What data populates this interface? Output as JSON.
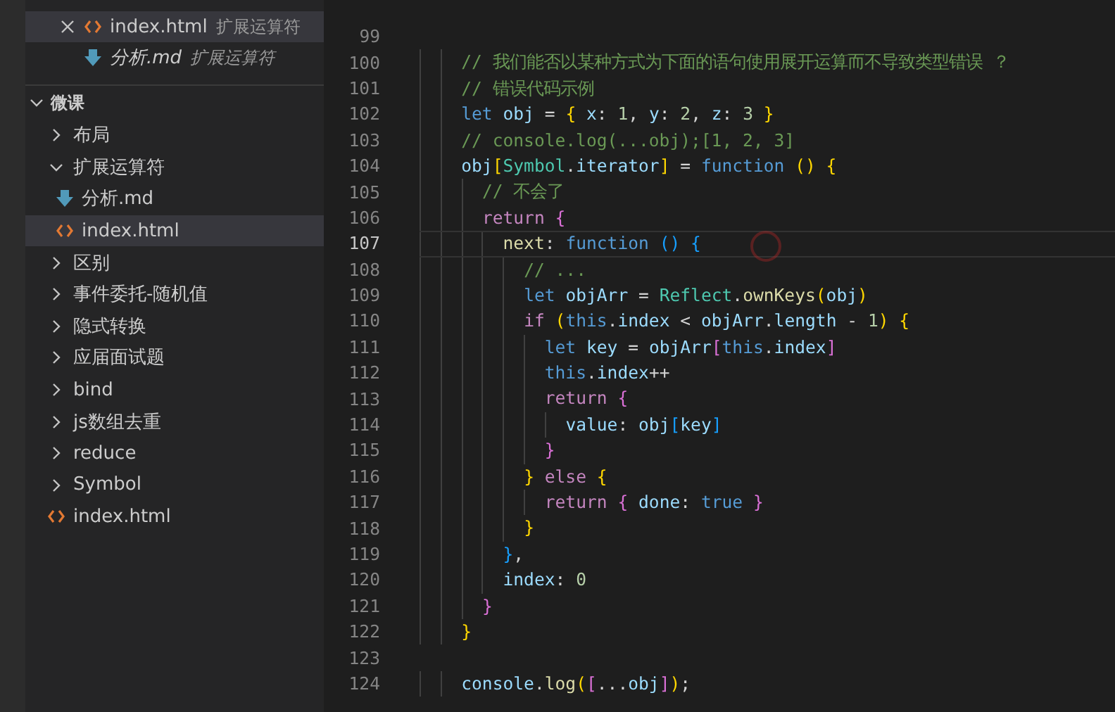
{
  "open_editors": [
    {
      "name": "index.html",
      "kind": "html",
      "description": "扩展运算符",
      "hovered": true,
      "preview": false
    },
    {
      "name": "分析.md",
      "kind": "md",
      "description": "扩展运算符",
      "hovered": false,
      "preview": true
    }
  ],
  "explorer": {
    "title": "微课",
    "expanded": true,
    "items": [
      {
        "name": "布局",
        "kind": "folder",
        "expanded": false,
        "selected": false
      },
      {
        "name": "扩展运算符",
        "kind": "folder",
        "expanded": true,
        "selected": false,
        "children": [
          {
            "name": "分析.md",
            "kind": "md",
            "selected": false
          },
          {
            "name": "index.html",
            "kind": "html",
            "selected": true
          }
        ]
      },
      {
        "name": "区别",
        "kind": "folder",
        "expanded": false,
        "selected": false
      },
      {
        "name": "事件委托-随机值",
        "kind": "folder",
        "expanded": false,
        "selected": false
      },
      {
        "name": "隐式转换",
        "kind": "folder",
        "expanded": false,
        "selected": false
      },
      {
        "name": "应届面试题",
        "kind": "folder",
        "expanded": false,
        "selected": false
      },
      {
        "name": "bind",
        "kind": "folder",
        "expanded": false,
        "selected": false
      },
      {
        "name": "js数组去重",
        "kind": "folder",
        "expanded": false,
        "selected": false
      },
      {
        "name": "reduce",
        "kind": "folder",
        "expanded": false,
        "selected": false
      },
      {
        "name": "Symbol",
        "kind": "folder",
        "expanded": false,
        "selected": false
      },
      {
        "name": "index.html",
        "kind": "html",
        "selected": false
      }
    ]
  },
  "editor": {
    "lines": [
      {
        "number": "99",
        "current": false
      },
      {
        "number": "100",
        "current": false,
        "tokens": [
          {
            "kind": "comment",
            "text": "    // 我们能否以某种方式为下面的语句使用展开运算而不导致类型错误 ？"
          }
        ]
      },
      {
        "number": "101",
        "current": false,
        "tokens": [
          {
            "kind": "comment",
            "text": "    // 错误代码示例"
          }
        ]
      },
      {
        "number": "102",
        "current": false,
        "tokens": [
          {
            "kind": "keyword",
            "text": "    let "
          },
          {
            "kind": "variable",
            "text": "obj"
          },
          {
            "kind": "plain",
            "text": " = "
          },
          {
            "kind": "brace1",
            "text": "{ "
          },
          {
            "kind": "variable",
            "text": "x"
          },
          {
            "kind": "plain",
            "text": ": "
          },
          {
            "kind": "number",
            "text": "1"
          },
          {
            "kind": "plain",
            "text": ", "
          },
          {
            "kind": "variable",
            "text": "y"
          },
          {
            "kind": "plain",
            "text": ": "
          },
          {
            "kind": "number",
            "text": "2"
          },
          {
            "kind": "plain",
            "text": ", "
          },
          {
            "kind": "variable",
            "text": "z"
          },
          {
            "kind": "plain",
            "text": ": "
          },
          {
            "kind": "number",
            "text": "3 "
          },
          {
            "kind": "brace1",
            "text": "}"
          }
        ]
      },
      {
        "number": "103",
        "current": false,
        "tokens": [
          {
            "kind": "comment",
            "text": "    // console.log(...obj);[1, 2, 3]"
          }
        ]
      },
      {
        "number": "104",
        "current": false,
        "tokens": [
          {
            "kind": "variable",
            "text": "    obj"
          },
          {
            "kind": "brace1",
            "text": "["
          },
          {
            "kind": "class",
            "text": "Symbol"
          },
          {
            "kind": "plain",
            "text": "."
          },
          {
            "kind": "variable",
            "text": "iterator"
          },
          {
            "kind": "brace1",
            "text": "]"
          },
          {
            "kind": "plain",
            "text": " = "
          },
          {
            "kind": "keyword",
            "text": "function "
          },
          {
            "kind": "brace1",
            "text": "() {"
          }
        ]
      },
      {
        "number": "105",
        "current": false,
        "tokens": [
          {
            "kind": "comment",
            "text": "      // 不会了"
          }
        ]
      },
      {
        "number": "106",
        "current": false,
        "tokens": [
          {
            "kind": "control",
            "text": "      return "
          },
          {
            "kind": "brace2",
            "text": "{"
          }
        ]
      },
      {
        "number": "107",
        "current": true,
        "tokens": [
          {
            "kind": "function",
            "text": "        next"
          },
          {
            "kind": "plain",
            "text": ": "
          },
          {
            "kind": "keyword",
            "text": "function "
          },
          {
            "kind": "brace3",
            "text": "() {"
          }
        ]
      },
      {
        "number": "108",
        "current": false,
        "tokens": [
          {
            "kind": "comment",
            "text": "          // ..."
          }
        ]
      },
      {
        "number": "109",
        "current": false,
        "tokens": [
          {
            "kind": "keyword",
            "text": "          let "
          },
          {
            "kind": "variable",
            "text": "objArr"
          },
          {
            "kind": "plain",
            "text": " = "
          },
          {
            "kind": "class",
            "text": "Reflect"
          },
          {
            "kind": "plain",
            "text": "."
          },
          {
            "kind": "function",
            "text": "ownKeys"
          },
          {
            "kind": "brace1",
            "text": "("
          },
          {
            "kind": "variable",
            "text": "obj"
          },
          {
            "kind": "brace1",
            "text": ")"
          }
        ]
      },
      {
        "number": "110",
        "current": false,
        "tokens": [
          {
            "kind": "control",
            "text": "          if "
          },
          {
            "kind": "brace1",
            "text": "("
          },
          {
            "kind": "keyword",
            "text": "this"
          },
          {
            "kind": "plain",
            "text": "."
          },
          {
            "kind": "variable",
            "text": "index"
          },
          {
            "kind": "plain",
            "text": " < "
          },
          {
            "kind": "variable",
            "text": "objArr"
          },
          {
            "kind": "plain",
            "text": "."
          },
          {
            "kind": "variable",
            "text": "length"
          },
          {
            "kind": "plain",
            "text": " - "
          },
          {
            "kind": "number",
            "text": "1"
          },
          {
            "kind": "brace1",
            "text": ") {"
          }
        ]
      },
      {
        "number": "111",
        "current": false,
        "tokens": [
          {
            "kind": "keyword",
            "text": "            let "
          },
          {
            "kind": "variable",
            "text": "key"
          },
          {
            "kind": "plain",
            "text": " = "
          },
          {
            "kind": "variable",
            "text": "objArr"
          },
          {
            "kind": "brace2",
            "text": "["
          },
          {
            "kind": "keyword",
            "text": "this"
          },
          {
            "kind": "plain",
            "text": "."
          },
          {
            "kind": "variable",
            "text": "index"
          },
          {
            "kind": "brace2",
            "text": "]"
          }
        ]
      },
      {
        "number": "112",
        "current": false,
        "tokens": [
          {
            "kind": "keyword",
            "text": "            this"
          },
          {
            "kind": "plain",
            "text": "."
          },
          {
            "kind": "variable",
            "text": "index"
          },
          {
            "kind": "plain",
            "text": "++"
          }
        ]
      },
      {
        "number": "113",
        "current": false,
        "tokens": [
          {
            "kind": "control",
            "text": "            return "
          },
          {
            "kind": "brace2",
            "text": "{"
          }
        ]
      },
      {
        "number": "114",
        "current": false,
        "tokens": [
          {
            "kind": "variable",
            "text": "              value"
          },
          {
            "kind": "plain",
            "text": ": "
          },
          {
            "kind": "variable",
            "text": "obj"
          },
          {
            "kind": "brace3",
            "text": "["
          },
          {
            "kind": "variable",
            "text": "key"
          },
          {
            "kind": "brace3",
            "text": "]"
          }
        ]
      },
      {
        "number": "115",
        "current": false,
        "tokens": [
          {
            "kind": "brace2",
            "text": "            }"
          }
        ]
      },
      {
        "number": "116",
        "current": false,
        "tokens": [
          {
            "kind": "brace1",
            "text": "          } "
          },
          {
            "kind": "control",
            "text": "else "
          },
          {
            "kind": "brace1",
            "text": "{"
          }
        ]
      },
      {
        "number": "117",
        "current": false,
        "tokens": [
          {
            "kind": "control",
            "text": "            return "
          },
          {
            "kind": "brace2",
            "text": "{ "
          },
          {
            "kind": "variable",
            "text": "done"
          },
          {
            "kind": "plain",
            "text": ": "
          },
          {
            "kind": "keyword",
            "text": "true "
          },
          {
            "kind": "brace2",
            "text": "}"
          }
        ]
      },
      {
        "number": "118",
        "current": false,
        "tokens": [
          {
            "kind": "brace1",
            "text": "          }"
          }
        ]
      },
      {
        "number": "119",
        "current": false,
        "tokens": [
          {
            "kind": "brace3",
            "text": "        }"
          },
          {
            "kind": "plain",
            "text": ","
          }
        ]
      },
      {
        "number": "120",
        "current": false,
        "tokens": [
          {
            "kind": "variable",
            "text": "        index"
          },
          {
            "kind": "plain",
            "text": ": "
          },
          {
            "kind": "number",
            "text": "0"
          }
        ]
      },
      {
        "number": "121",
        "current": false,
        "tokens": [
          {
            "kind": "brace2",
            "text": "      }"
          }
        ]
      },
      {
        "number": "122",
        "current": false,
        "tokens": [
          {
            "kind": "brace1",
            "text": "    }"
          }
        ]
      },
      {
        "number": "123",
        "current": false
      },
      {
        "number": "124",
        "current": false,
        "tokens": [
          {
            "kind": "variable",
            "text": "    console"
          },
          {
            "kind": "plain",
            "text": "."
          },
          {
            "kind": "function",
            "text": "log"
          },
          {
            "kind": "brace1",
            "text": "("
          },
          {
            "kind": "brace2",
            "text": "["
          },
          {
            "kind": "plain",
            "text": "..."
          },
          {
            "kind": "variable",
            "text": "obj"
          },
          {
            "kind": "brace2",
            "text": "]"
          },
          {
            "kind": "brace1",
            "text": ")"
          },
          {
            "kind": "plain",
            "text": ";"
          }
        ]
      }
    ]
  }
}
